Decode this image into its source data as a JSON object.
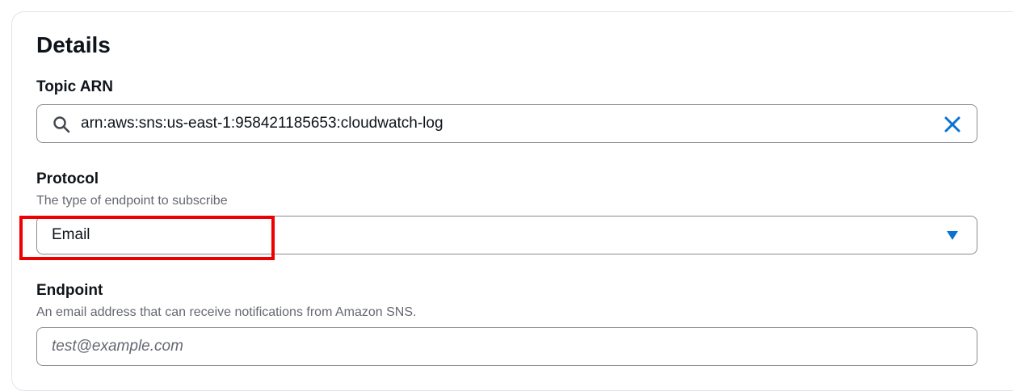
{
  "section": {
    "title": "Details"
  },
  "topic_arn": {
    "label": "Topic ARN",
    "value": "arn:aws:sns:us-east-1:958421185653:cloudwatch-log",
    "icons": [
      "search-icon",
      "clear-icon"
    ]
  },
  "protocol": {
    "label": "Protocol",
    "description": "The type of endpoint to subscribe",
    "selected": "Email",
    "icons": [
      "caret-down-icon"
    ]
  },
  "endpoint": {
    "label": "Endpoint",
    "description": "An email address that can receive notifications from Amazon SNS.",
    "placeholder": "test@example.com"
  },
  "colors": {
    "accent": "#0972d3",
    "highlight": "#ee0000",
    "text": "#0f141a",
    "muted": "#656871",
    "border": "#8c8c94"
  }
}
